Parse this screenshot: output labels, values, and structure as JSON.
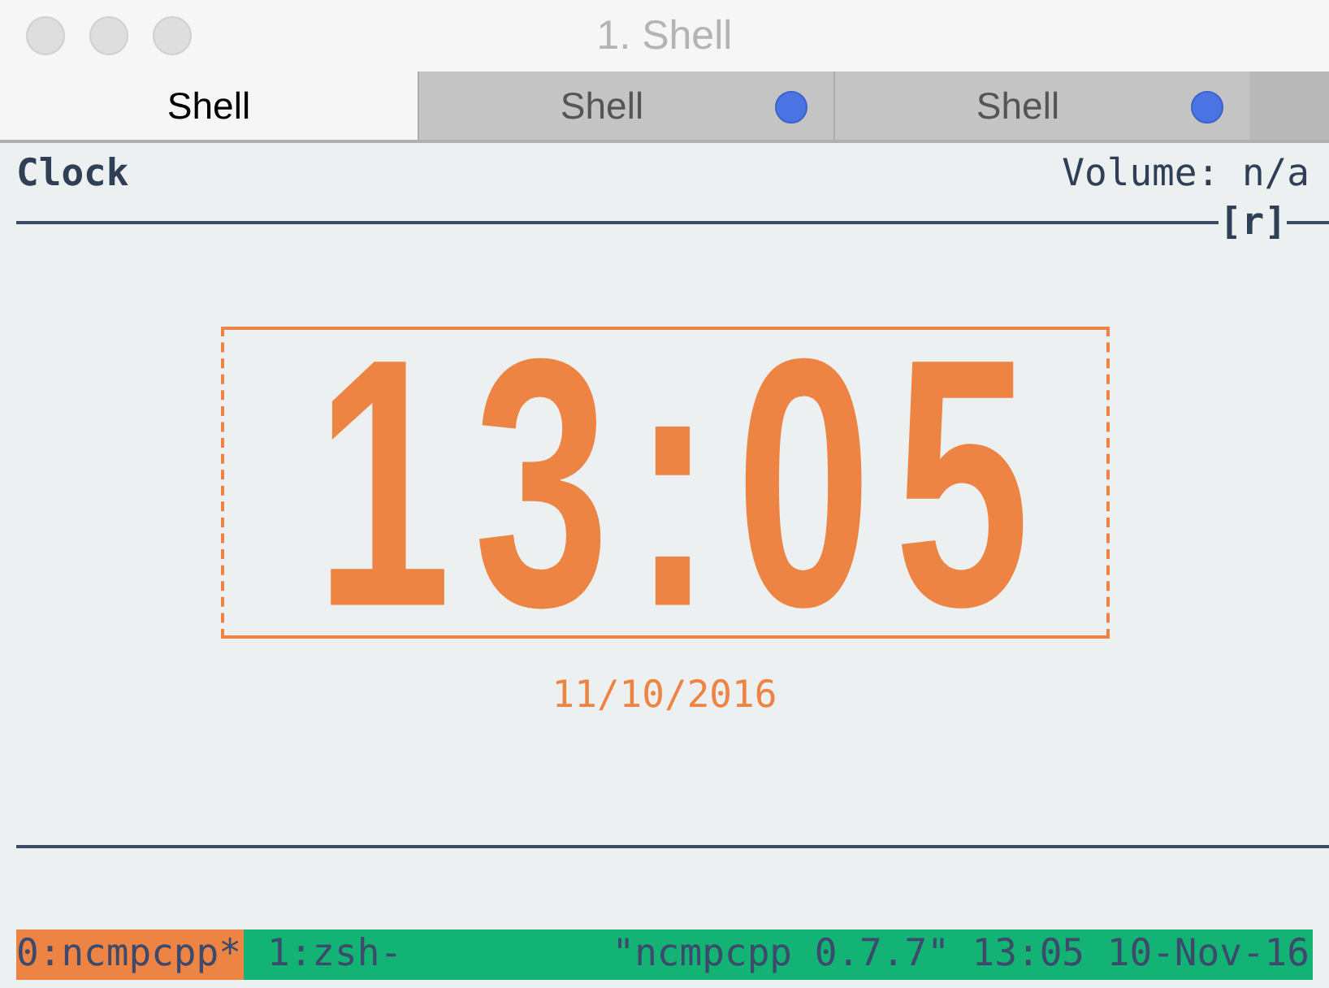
{
  "window": {
    "title": "1. Shell"
  },
  "tabs": [
    {
      "label": "Shell",
      "selected": true,
      "activity": false
    },
    {
      "label": "Shell",
      "selected": false,
      "activity": true
    },
    {
      "label": "Shell",
      "selected": false,
      "activity": true
    }
  ],
  "header": {
    "title": "Clock",
    "volume": "Volume: n/a",
    "flags": "[r]"
  },
  "clock": {
    "time": "13:05",
    "date": "11/10/2016"
  },
  "status_bar": {
    "windows": [
      {
        "label": "0:ncmpcpp*",
        "selected": true
      },
      {
        "label": "1:zsh-",
        "selected": false
      }
    ],
    "right": "\"ncmpcpp 0.7.7\" 13:05 10-Nov-16"
  }
}
